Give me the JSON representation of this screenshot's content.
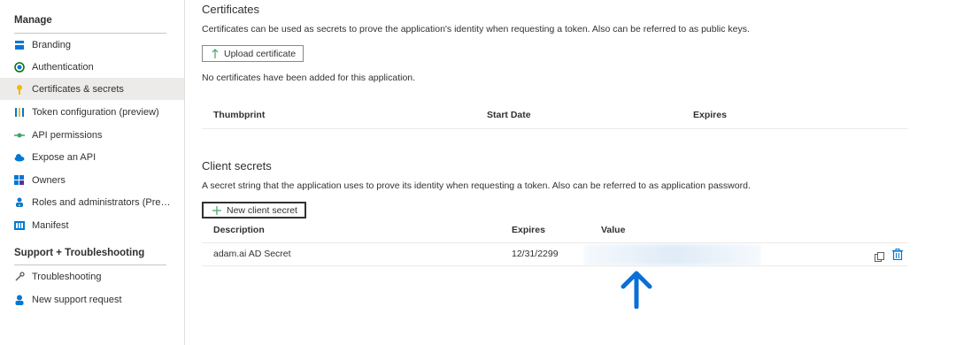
{
  "sidebar": {
    "manage_header": "Manage",
    "items": [
      {
        "label": "Branding",
        "icon": "branding-icon"
      },
      {
        "label": "Authentication",
        "icon": "authentication-icon"
      },
      {
        "label": "Certificates & secrets",
        "icon": "key-icon",
        "selected": true
      },
      {
        "label": "Token configuration (preview)",
        "icon": "token-config-icon"
      },
      {
        "label": "API permissions",
        "icon": "api-permissions-icon"
      },
      {
        "label": "Expose an API",
        "icon": "cloud-icon"
      },
      {
        "label": "Owners",
        "icon": "owners-icon"
      },
      {
        "label": "Roles and administrators (Previ...",
        "icon": "roles-icon"
      },
      {
        "label": "Manifest",
        "icon": "manifest-icon"
      }
    ],
    "support_header": "Support + Troubleshooting",
    "support_items": [
      {
        "label": "Troubleshooting",
        "icon": "wrench-icon"
      },
      {
        "label": "New support request",
        "icon": "support-person-icon"
      }
    ]
  },
  "certificates": {
    "title": "Certificates",
    "description": "Certificates can be used as secrets to prove the application's identity when requesting a token. Also can be referred to as public keys.",
    "upload_button": "Upload certificate",
    "empty_message": "No certificates have been added for this application.",
    "columns": [
      "Thumbprint",
      "Start Date",
      "Expires"
    ]
  },
  "client_secrets": {
    "title": "Client secrets",
    "description": "A secret string that the application uses to prove its identity when requesting a token. Also can be referred to as application password.",
    "new_button": "New client secret",
    "columns": [
      "Description",
      "Expires",
      "Value"
    ],
    "rows": [
      {
        "description": "adam.ai AD Secret",
        "expires": "12/31/2299",
        "value": ""
      }
    ]
  },
  "colors": {
    "accent_blue": "#0078d4",
    "annotation_arrow": "#0a6fd6",
    "selected_bg": "#edebe9"
  }
}
